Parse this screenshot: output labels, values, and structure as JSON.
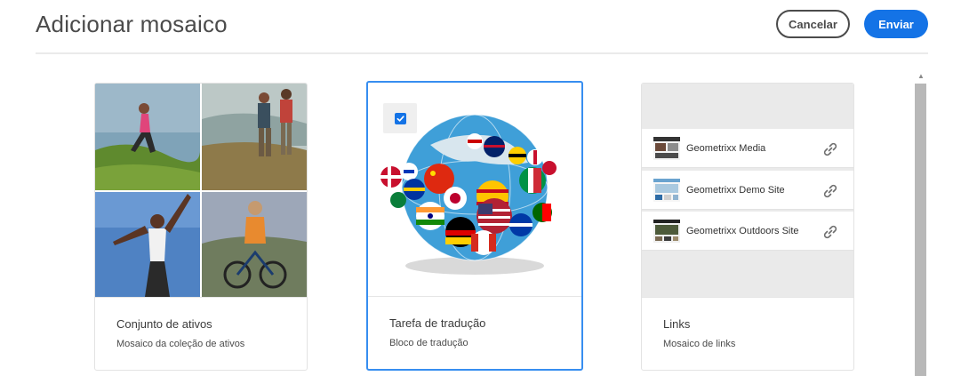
{
  "header": {
    "title": "Adicionar mosaico",
    "cancel_label": "Cancelar",
    "submit_label": "Enviar"
  },
  "cards": [
    {
      "title": "Conjunto de ativos",
      "subtitle": "Mosaico da coleção de ativos",
      "selected": false
    },
    {
      "title": "Tarefa de tradução",
      "subtitle": "Bloco de tradução",
      "selected": true
    },
    {
      "title": "Links",
      "subtitle": "Mosaico de links",
      "selected": false,
      "links": [
        {
          "label": "Geometrixx Media",
          "icon": "link-icon"
        },
        {
          "label": "Geometrixx Demo Site",
          "icon": "link-icon"
        },
        {
          "label": "Geometrixx Outdoors Site",
          "icon": "link-icon"
        }
      ]
    }
  ],
  "colors": {
    "accent": "#1473e6",
    "selected_border": "#378ef0"
  }
}
